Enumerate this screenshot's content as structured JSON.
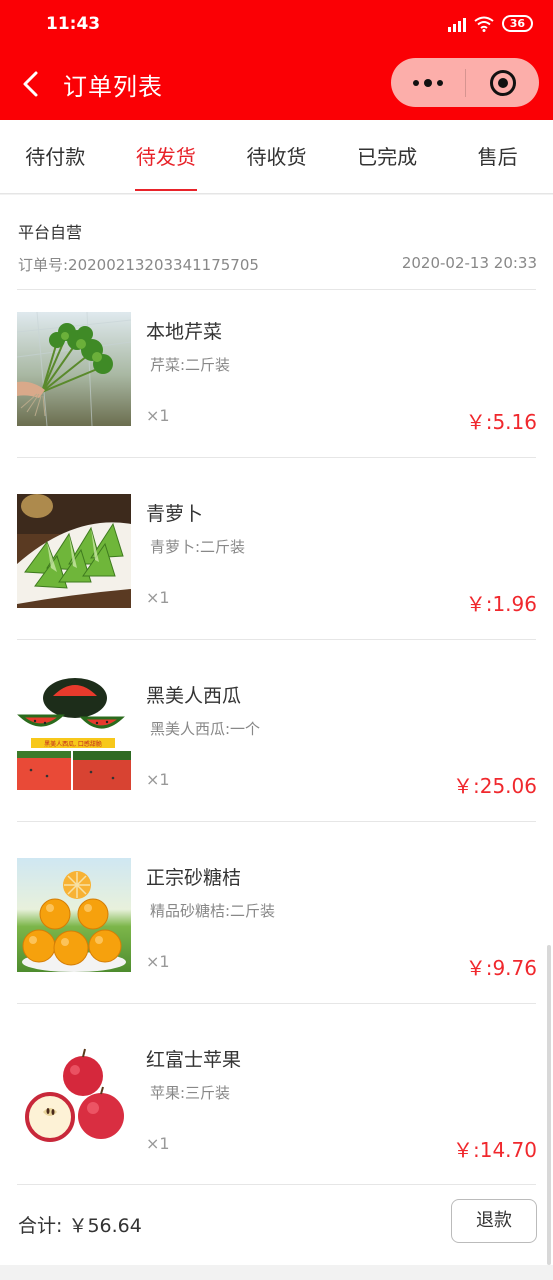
{
  "status_bar": {
    "time": "11:43",
    "battery": "36"
  },
  "nav": {
    "title": "订单列表"
  },
  "tabs": [
    {
      "label": "待付款",
      "active": false
    },
    {
      "label": "待发货",
      "active": true
    },
    {
      "label": "待收货",
      "active": false
    },
    {
      "label": "已完成",
      "active": false
    },
    {
      "label": "售后",
      "active": false
    }
  ],
  "order": {
    "shop": "平台自营",
    "order_no": "订单号:20200213203341175705",
    "date": "2020-02-13 20:33",
    "items": [
      {
        "name": "本地芹菜",
        "spec": "芹菜:二斤装",
        "qty": "×1",
        "price": "￥:5.16",
        "image": "celery"
      },
      {
        "name": "青萝卜",
        "spec": "青萝卜:二斤装",
        "qty": "×1",
        "price": "￥:1.96",
        "image": "radish"
      },
      {
        "name": "黑美人西瓜",
        "spec": "黑美人西瓜:一个",
        "qty": "×1",
        "price": "￥:25.06",
        "image": "watermelon",
        "image_caption": "黑美人西瓜, 口感甜脆"
      },
      {
        "name": "正宗砂糖桔",
        "spec": "精品砂糖桔:二斤装",
        "qty": "×1",
        "price": "￥:9.76",
        "image": "tangerine"
      },
      {
        "name": "红富士苹果",
        "spec": "苹果:三斤装",
        "qty": "×1",
        "price": "￥:14.70",
        "image": "apple"
      }
    ],
    "total": "合计: ￥56.64",
    "refund_label": "退款"
  },
  "colors": {
    "brand_red": "#fb0005",
    "price_red": "#f0282d",
    "capsule": "#fcaeaa"
  }
}
